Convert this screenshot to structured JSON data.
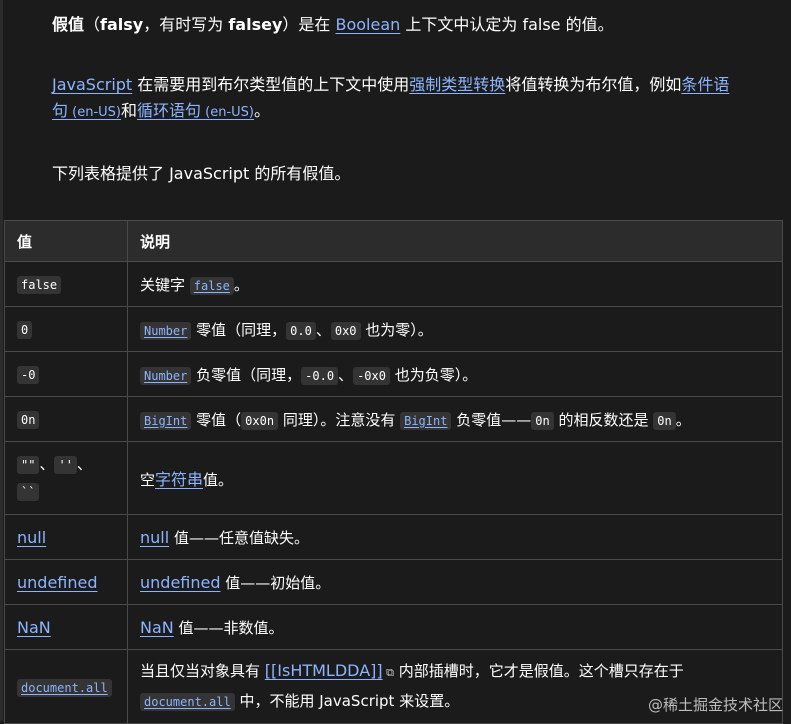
{
  "intro": {
    "p1": {
      "bold_a": "假值",
      "text_b": "（",
      "bold_c": "falsy",
      "text_d": "，有时写为 ",
      "bold_e": "falsey",
      "text_f": "）是在 ",
      "link_boolean": "Boolean",
      "text_g": " 上下文中认定为 false 的值。"
    },
    "p2": {
      "link_js": "JavaScript",
      "text_a": " 在需要用到布尔类型值的上下文中使用",
      "link_coercion": "强制类型转换",
      "text_b": "将值转换为布尔值，例如",
      "link_cond_a": "条件语",
      "link_cond_b": "句",
      "link_cond_lang": " (en-US)",
      "text_c": "和",
      "link_loop": "循环语句",
      "link_loop_lang": " (en-US)",
      "text_d": "。"
    },
    "p3": "下列表格提供了 JavaScript 的所有假值。"
  },
  "table": {
    "headers": [
      "值",
      "说明"
    ],
    "rows": [
      {
        "value": "false",
        "desc_a": "关键字 ",
        "code1": "false",
        "desc_b": "。"
      },
      {
        "value": "0",
        "code1": "Number",
        "desc_a": " 零值（同理，",
        "code2": "0.0",
        "desc_b": "、",
        "code3": "0x0",
        "desc_c": " 也为零）。"
      },
      {
        "value": "-0",
        "code1": "Number",
        "desc_a": " 负零值（同理，",
        "code2": "-0.0",
        "desc_b": "、",
        "code3": "-0x0",
        "desc_c": " 也为负零）。"
      },
      {
        "value": "0n",
        "code1": "BigInt",
        "desc_a": " 零值（",
        "code2": "0x0n",
        "desc_b": " 同理）。注意没有 ",
        "code3": "BigInt",
        "desc_c": " 负零值——",
        "code4": "0n",
        "desc_d": " 的相反数还是 ",
        "code5": "0n",
        "desc_e": "。"
      },
      {
        "v1": "\"\"",
        "sep1": "、",
        "v2": "''",
        "sep2": "、",
        "v3": "``",
        "desc_a": "空",
        "link": "字符串",
        "desc_b": "值。"
      },
      {
        "value": "null",
        "link": "null",
        "desc_a": " 值——任意值缺失。"
      },
      {
        "value": "undefined",
        "link": "undefined",
        "desc_a": " 值——初始值。"
      },
      {
        "value": "NaN",
        "link": "NaN",
        "desc_a": " 值——非数值。"
      },
      {
        "value": "document.all",
        "desc_a": "当且仅当对象具有 ",
        "link": "[[IsHTMLDDA]]",
        "desc_b": " 内部插槽时，它才是假值。这个槽只存在于",
        "code1": "document.all",
        "desc_c": " 中，不能用 JavaScript 来设置。"
      }
    ]
  },
  "watermark": "@稀土掘金技术社区"
}
